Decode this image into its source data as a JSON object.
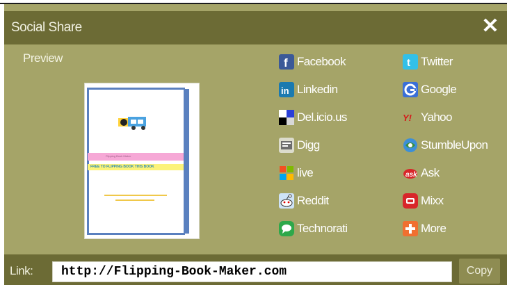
{
  "dialog": {
    "title": "Social Share",
    "close_symbol": "✕",
    "preview_label": "Preview"
  },
  "book_preview": {
    "pink_text": "Flipping Book Maker",
    "yellow_text": "FREE TO FLIPPING BOOK THIS BOOK"
  },
  "share": {
    "left_column": [
      {
        "label": "Facebook",
        "icon": "facebook-icon",
        "color": "#3b5998"
      },
      {
        "label": "Linkedin",
        "icon": "linkedin-icon",
        "color": "#1a7ab0"
      },
      {
        "label": "Del.icio.us",
        "icon": "delicious-icon",
        "color": "#2a3fd8"
      },
      {
        "label": "Digg",
        "icon": "digg-icon",
        "color": "#b8b8a8"
      },
      {
        "label": "live",
        "icon": "live-icon",
        "color": "#f4a020"
      },
      {
        "label": "Reddit",
        "icon": "reddit-icon",
        "color": "#cee3f8"
      },
      {
        "label": "Technorati",
        "icon": "technorati-icon",
        "color": "#2ea84a"
      }
    ],
    "right_column": [
      {
        "label": "Twitter",
        "icon": "twitter-icon",
        "color": "#33c0e8"
      },
      {
        "label": "Google",
        "icon": "google-icon",
        "color": "#3a6fd8"
      },
      {
        "label": "Yahoo",
        "icon": "yahoo-icon",
        "color": "#d41a1a"
      },
      {
        "label": "StumbleUpon",
        "icon": "stumbleupon-icon",
        "color": "#3c8f3c"
      },
      {
        "label": "Ask",
        "icon": "ask-icon",
        "color": "#d8262a"
      },
      {
        "label": "Mixx",
        "icon": "mixx-icon",
        "color": "#d8262a"
      },
      {
        "label": "More",
        "icon": "more-icon",
        "color": "#f07030"
      }
    ]
  },
  "link_bar": {
    "label": "Link:",
    "value": "http://Flipping-Book-Maker.com",
    "copy_label": "Copy"
  }
}
